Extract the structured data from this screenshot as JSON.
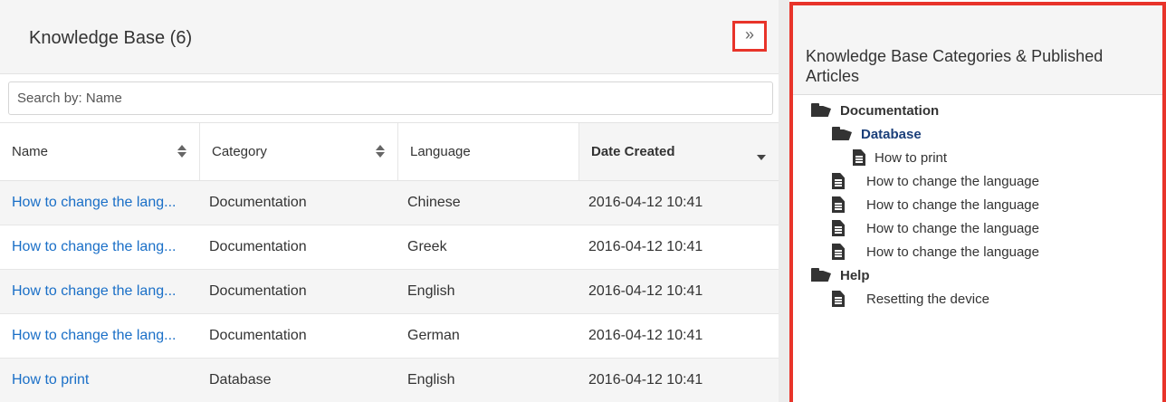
{
  "left_panel": {
    "title": "Knowledge Base (6)",
    "toggle_glyph": "»",
    "search_placeholder": "Search by: Name",
    "columns": [
      "Name",
      "Category",
      "Language",
      "Date Created"
    ],
    "rows": [
      {
        "name": "How to change the lang...",
        "category": "Documentation",
        "language": "Chinese",
        "date": "2016-04-12 10:41"
      },
      {
        "name": "How to change the lang...",
        "category": "Documentation",
        "language": "Greek",
        "date": "2016-04-12 10:41"
      },
      {
        "name": "How to change the lang...",
        "category": "Documentation",
        "language": "English",
        "date": "2016-04-12 10:41"
      },
      {
        "name": "How to change the lang...",
        "category": "Documentation",
        "language": "German",
        "date": "2016-04-12 10:41"
      },
      {
        "name": "How to print",
        "category": "Database",
        "language": "English",
        "date": "2016-04-12 10:41"
      }
    ]
  },
  "right_panel": {
    "title": "Knowledge Base Categories & Published Articles",
    "tree": [
      {
        "type": "folder",
        "label": "Documentation",
        "depth": 0
      },
      {
        "type": "folder",
        "label": "Database",
        "depth": 1,
        "active": true
      },
      {
        "type": "doc",
        "label": "How to print",
        "depth": 2
      },
      {
        "type": "doc",
        "label": "How to change the language",
        "depth": 1
      },
      {
        "type": "doc",
        "label": "How to change the language",
        "depth": 1
      },
      {
        "type": "doc",
        "label": "How to change the language",
        "depth": 1
      },
      {
        "type": "doc",
        "label": "How to change the language",
        "depth": 1
      },
      {
        "type": "folder",
        "label": "Help",
        "depth": 0
      },
      {
        "type": "doc",
        "label": "Resetting the device",
        "depth": 1
      }
    ]
  },
  "colors": {
    "highlight": "#e8342a",
    "link": "#1a6fc7",
    "active_folder": "#1b3f7a"
  },
  "icons": {
    "toggle": "double-chevron-right-icon",
    "sort": "sort-both-icon",
    "sort_active": "caret-down-icon",
    "folder": "folder-open-icon",
    "doc": "file-text-icon"
  }
}
